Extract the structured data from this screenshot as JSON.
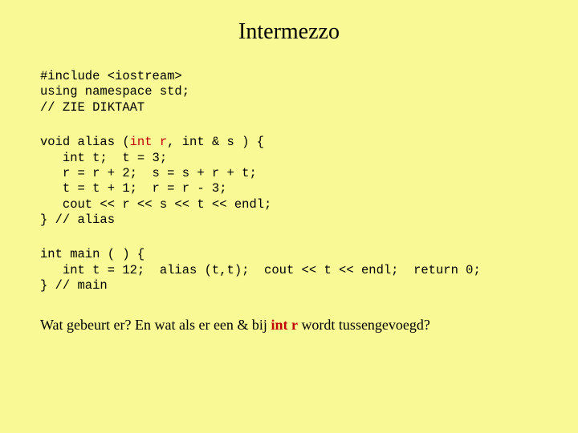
{
  "title": "Intermezzo",
  "code": {
    "block1_line1": "#include <iostream>",
    "block1_line2": "using namespace std;",
    "block1_line3": "// ZIE DIKTAAT",
    "block2_line1a": "void alias (",
    "block2_line1_kw": "int r",
    "block2_line1b": ", int & s ) {",
    "block2_line2": "   int t;  t = 3;",
    "block2_line3": "   r = r + 2;  s = s + r + t;",
    "block2_line4": "   t = t + 1;  r = r - 3;",
    "block2_line5": "   cout << r << s << t << endl;",
    "block2_line6": "} // alias",
    "block3_line1": "int main ( ) {",
    "block3_line2": "   int t = 12;  alias (t,t);  cout << t << endl;  return 0;",
    "block3_line3": "} // main"
  },
  "question": {
    "part1": "Wat gebeurt er? En wat als er een & bij ",
    "kw": "int r",
    "part2": " wordt tussengevoegd?"
  }
}
